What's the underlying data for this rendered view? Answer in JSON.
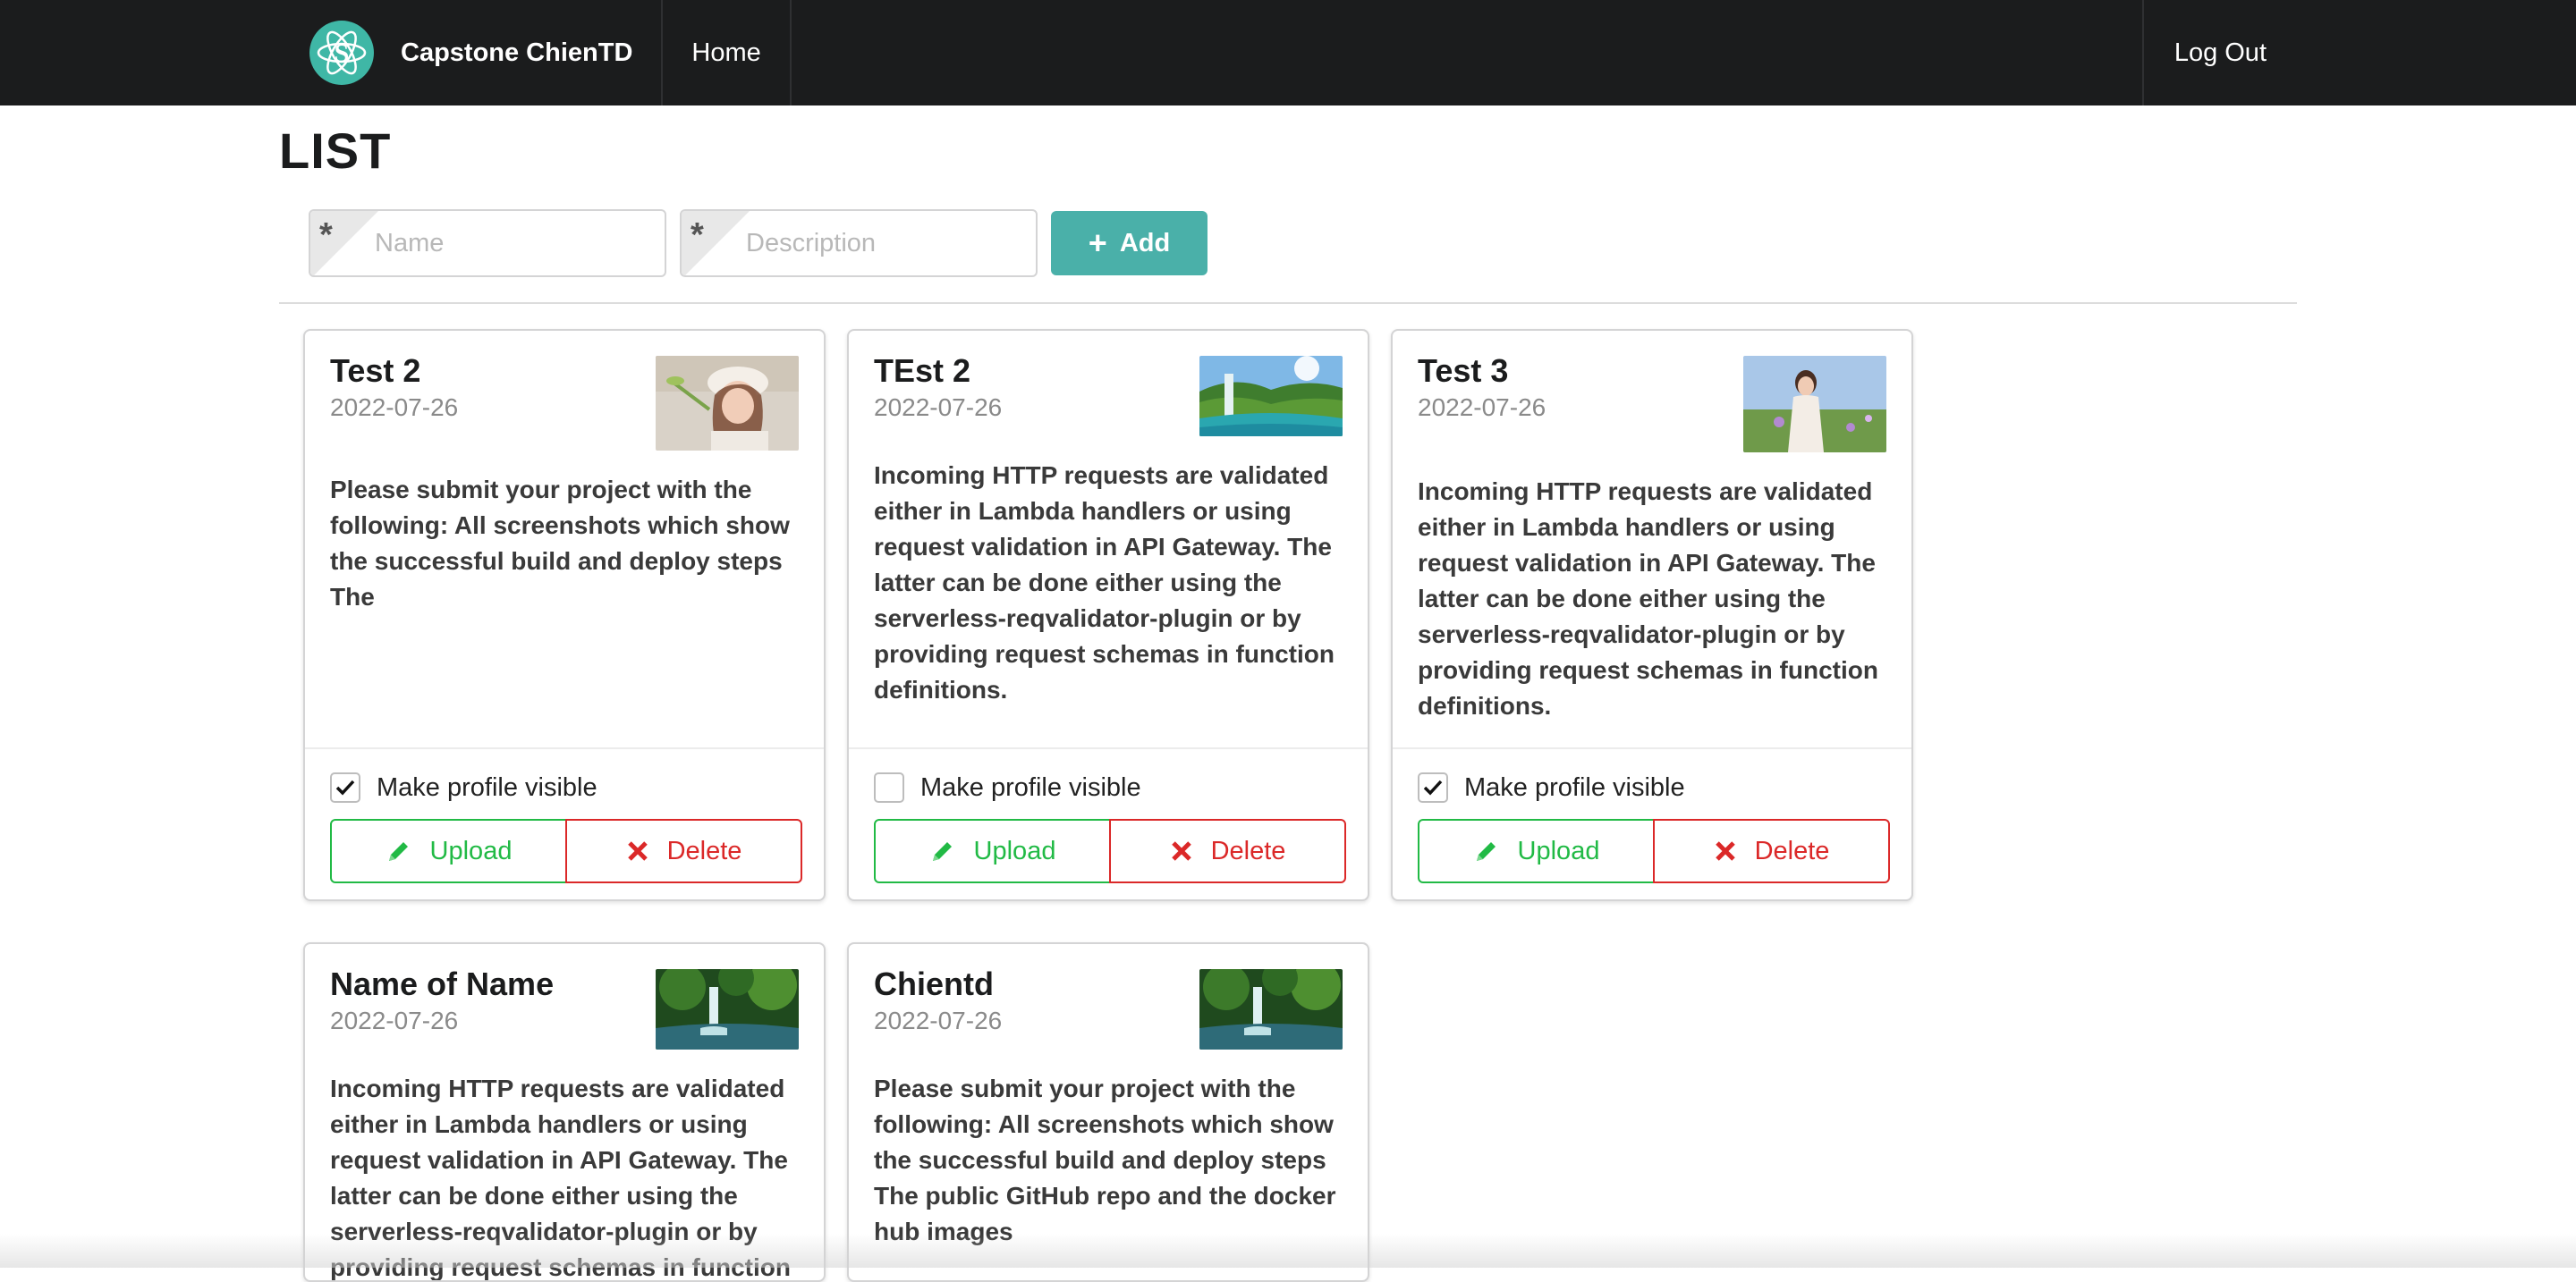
{
  "navbar": {
    "brand": "Capstone ChienTD",
    "home": "Home",
    "logout": "Log Out"
  },
  "page": {
    "title": "LIST"
  },
  "form": {
    "name_placeholder": "Name",
    "description_placeholder": "Description",
    "required_mark": "*",
    "add_label": "Add"
  },
  "cards": [
    {
      "title": "Test 2",
      "date": "2022-07-26",
      "description": "Please submit your project with the following: All screenshots which show the successful build and deploy steps The",
      "visible": true,
      "checkbox_label": "Make profile visible",
      "upload_label": "Upload",
      "delete_label": "Delete",
      "thumbnail": "portrait-photo"
    },
    {
      "title": "TEst 2",
      "date": "2022-07-26",
      "description": "Incoming HTTP requests are validated either in Lambda handlers or using request validation in API Gateway. The latter can be done either using the serverless-reqvalidator-plugin or by providing request schemas in function definitions.",
      "visible": false,
      "checkbox_label": "Make profile visible",
      "upload_label": "Upload",
      "delete_label": "Delete",
      "thumbnail": "waterfall-landscape"
    },
    {
      "title": "Test 3",
      "date": "2022-07-26",
      "description": "Incoming HTTP requests are validated either in Lambda handlers or using request validation in API Gateway. The latter can be done either using the serverless-reqvalidator-plugin or by providing request schemas in function definitions.",
      "visible": true,
      "checkbox_label": "Make profile visible",
      "upload_label": "Upload",
      "delete_label": "Delete",
      "thumbnail": "portrait-field"
    },
    {
      "title": "Name of Name",
      "date": "2022-07-26",
      "description": "Incoming HTTP requests are validated either in Lambda handlers or using request validation in API Gateway. The latter can be done either using the serverless-reqvalidator-plugin or by providing request schemas in function",
      "thumbnail": "forest-waterfall"
    },
    {
      "title": "Chientd",
      "date": "2022-07-26",
      "description": "Please submit your project with the following: All screenshots which show the successful build and deploy steps The public GitHub repo and the docker hub images",
      "thumbnail": "forest-waterfall"
    }
  ],
  "colors": {
    "navbar_bg": "#1b1c1d",
    "brand_logo": "#3fb7a6",
    "add_button": "#4ab0a9",
    "upload": "#21ba45",
    "delete": "#db2828"
  },
  "icons": {
    "brand": "react-atom-icon",
    "add": "plus-icon",
    "upload": "pencil-icon",
    "delete": "x-icon",
    "checked": "checkmark-icon"
  }
}
